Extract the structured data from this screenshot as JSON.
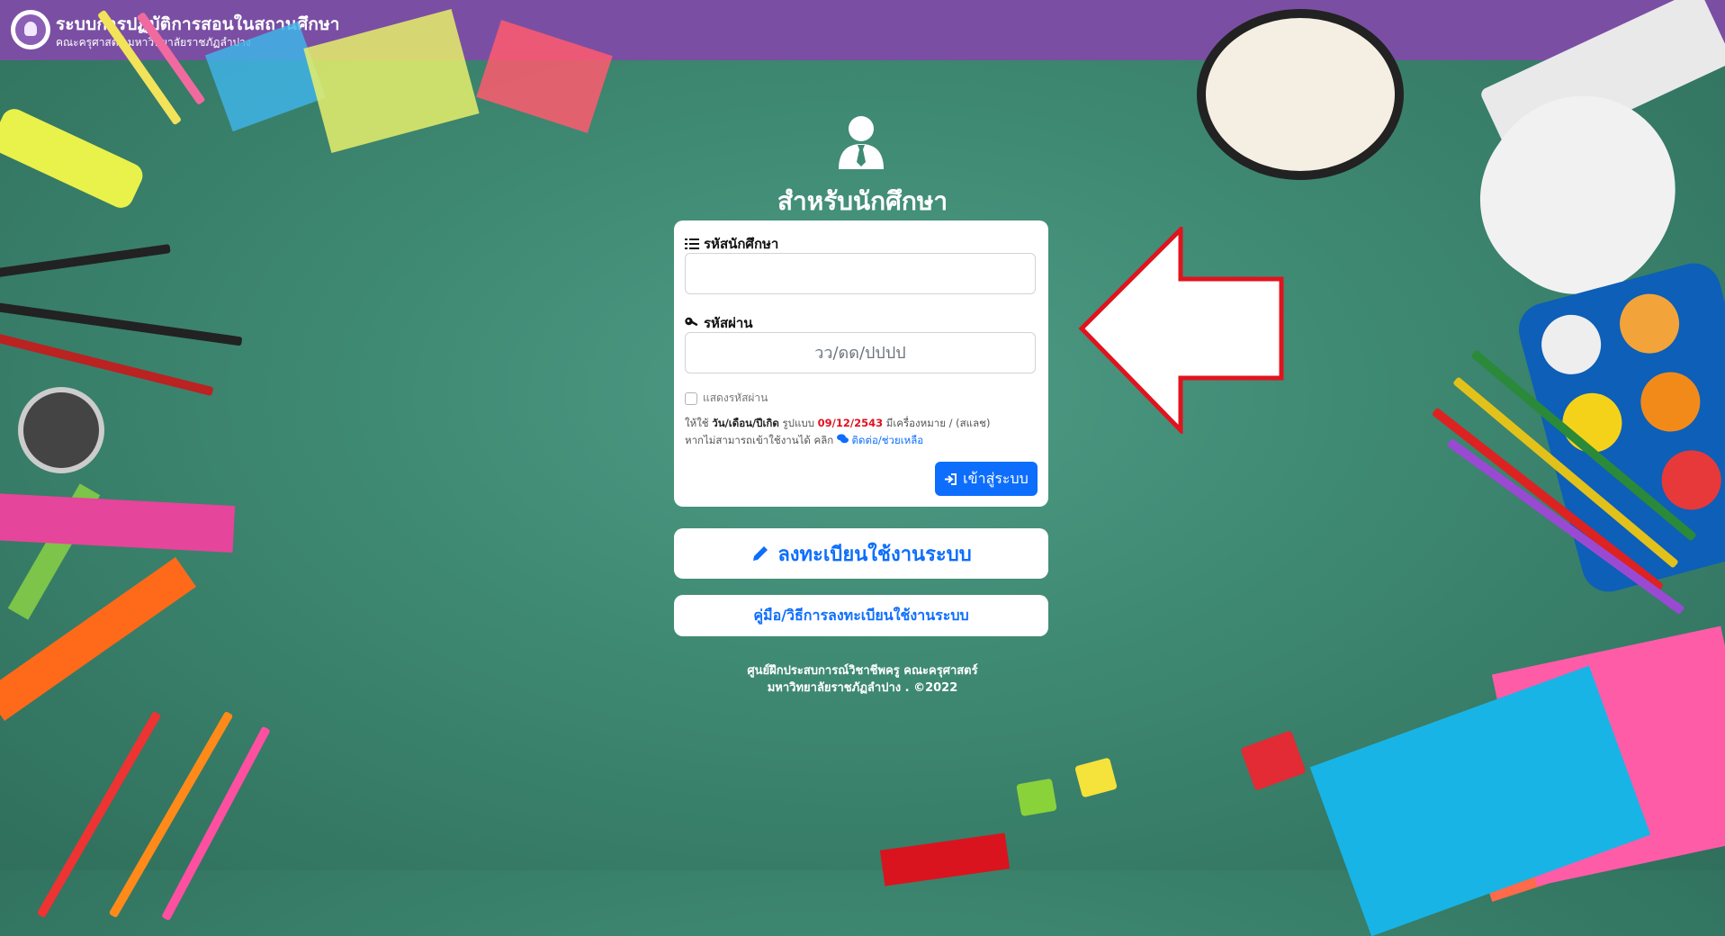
{
  "header": {
    "title": "ระบบการปฏิบัติการสอนในสถานศึกษา",
    "subtitle": "คณะครุศาสตร์ มหาวิทยาลัยราชภัฏลำปาง",
    "bg_color": "#7a4fa3"
  },
  "login": {
    "heading": "สำหรับนักศึกษา",
    "student_id_label": "รหัสนักศึกษา",
    "student_id_value": "",
    "password_label": "รหัสผ่าน",
    "password_placeholder": "วว/ดด/ปปปป",
    "show_password_label": "แสดงรหัสผ่าน",
    "hint_line1_prefix": "ให้ใช้ ",
    "hint_line1_bold": "วัน/เดือน/ปีเกิด",
    "hint_line1_mid": " รูปแบบ ",
    "hint_line1_example": "09/12/2543",
    "hint_line1_suffix": " มีเครื่องหมาย / (สแลช)",
    "hint_line2_prefix": "หากไม่สามารถเข้าใช้งานได้ คลิก ",
    "hint_line2_link": "ติดต่อ/ช่วยเหลือ",
    "login_button": "เข้าสู่ระบบ",
    "accent_color": "#0d6efd"
  },
  "register_button": "ลงทะเบียนใช้งานระบบ",
  "manual_button": "คู่มือ/วิธีการลงทะเบียนใช้งานระบบ",
  "footer": {
    "line1": "ศูนย์ฝึกประสบการณ์วิชาชีพครู คณะครุศาสตร์",
    "line2": "มหาวิทยาลัยราชภัฏลำปาง . ©2022"
  },
  "icons": {
    "user": "user-tie-icon",
    "list": "list-ol-icon",
    "key": "key-icon",
    "login": "sign-in-icon",
    "comments": "comments-icon",
    "pencil": "pencil-icon",
    "arrow": "left-arrow-icon"
  }
}
